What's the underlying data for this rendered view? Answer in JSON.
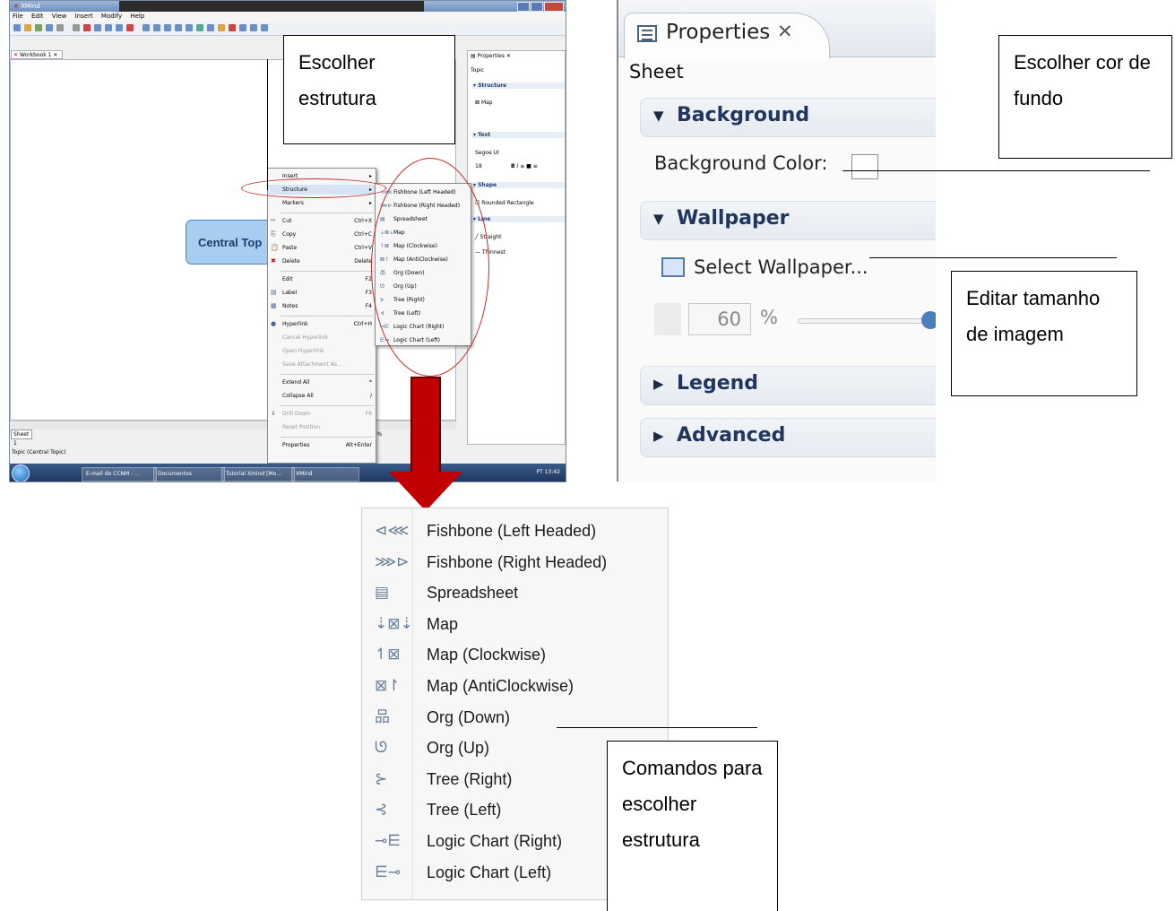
{
  "xmind_window": {
    "title": "XMind",
    "menu": [
      "File",
      "Edit",
      "View",
      "Insert",
      "Modify",
      "Help"
    ],
    "editor_tab": "Workbook 1",
    "central_topic": "Central Top",
    "sheet_tab": "Sheet 1",
    "zoom": "100%",
    "status": "Topic (Central Topic)",
    "taskbar": [
      "E-mail de CCNM - ...",
      "Documentos",
      "Tutorial Xmind [Mo...",
      "XMind"
    ],
    "tray": "PT  13:42",
    "properties": {
      "tab": "Properties",
      "context": "Topic",
      "structure_section": "Structure",
      "structure_value": "Map",
      "text_section": "Text",
      "font": "Segoe UI",
      "font_size": "18",
      "shape_section": "Shape",
      "shape_value": "Rounded Rectangle",
      "line_section": "Line",
      "line_style": "Straight",
      "line_width": "Thinnest"
    },
    "context_menu": [
      {
        "label": "Insert",
        "shortcut": "",
        "arrow": true,
        "disabled": false
      },
      {
        "label": "Structure",
        "shortcut": "",
        "arrow": true,
        "disabled": false
      },
      {
        "label": "Markers",
        "shortcut": "",
        "arrow": true,
        "disabled": false
      },
      {
        "label": "Cut",
        "shortcut": "Ctrl+X",
        "arrow": false,
        "disabled": false
      },
      {
        "label": "Copy",
        "shortcut": "Ctrl+C",
        "arrow": false,
        "disabled": false
      },
      {
        "label": "Paste",
        "shortcut": "Ctrl+V",
        "arrow": false,
        "disabled": false
      },
      {
        "label": "Delete",
        "shortcut": "Delete",
        "arrow": false,
        "disabled": false
      },
      {
        "label": "Edit",
        "shortcut": "F2",
        "arrow": false,
        "disabled": false
      },
      {
        "label": "Label",
        "shortcut": "F3",
        "arrow": false,
        "disabled": false
      },
      {
        "label": "Notes",
        "shortcut": "F4",
        "arrow": false,
        "disabled": false
      },
      {
        "label": "Hyperlink",
        "shortcut": "Ctrl+H",
        "arrow": false,
        "disabled": false
      },
      {
        "label": "Cancel Hyperlink",
        "shortcut": "",
        "arrow": false,
        "disabled": true
      },
      {
        "label": "Open Hyperlink",
        "shortcut": "",
        "arrow": false,
        "disabled": true
      },
      {
        "label": "Save Attachment As...",
        "shortcut": "",
        "arrow": false,
        "disabled": true
      },
      {
        "label": "Extend All",
        "shortcut": "*",
        "arrow": false,
        "disabled": false
      },
      {
        "label": "Collapse All",
        "shortcut": "/",
        "arrow": false,
        "disabled": false
      },
      {
        "label": "Drill Down",
        "shortcut": "F6",
        "arrow": false,
        "disabled": true
      },
      {
        "label": "Reset Position",
        "shortcut": "",
        "arrow": false,
        "disabled": true
      },
      {
        "label": "Properties",
        "shortcut": "Alt+Enter",
        "arrow": false,
        "disabled": false
      }
    ]
  },
  "structure_options": [
    {
      "label": "Fishbone (Left Headed)",
      "icon": "fishbone-left-icon",
      "glyph": "⊲⋘"
    },
    {
      "label": "Fishbone (Right Headed)",
      "icon": "fishbone-right-icon",
      "glyph": "⋙⊳"
    },
    {
      "label": "Spreadsheet",
      "icon": "spreadsheet-icon",
      "glyph": "▤"
    },
    {
      "label": "Map",
      "icon": "map-icon",
      "glyph": "⇣⊠⇣"
    },
    {
      "label": "Map (Clockwise)",
      "icon": "map-clockwise-icon",
      "glyph": "↿⊠"
    },
    {
      "label": "Map (AntiClockwise)",
      "icon": "map-anticlockwise-icon",
      "glyph": "⊠↾"
    },
    {
      "label": "Org (Down)",
      "icon": "org-down-icon",
      "glyph": "品"
    },
    {
      "label": "Org (Up)",
      "icon": "org-up-icon",
      "glyph": "ᘎ"
    },
    {
      "label": "Tree (Right)",
      "icon": "tree-right-icon",
      "glyph": "⊱"
    },
    {
      "label": "Tree (Left)",
      "icon": "tree-left-icon",
      "glyph": "⊰"
    },
    {
      "label": "Logic Chart (Right)",
      "icon": "logic-chart-right-icon",
      "glyph": "⊸⋿"
    },
    {
      "label": "Logic Chart (Left)",
      "icon": "logic-chart-left-icon",
      "glyph": "⋿⊸"
    }
  ],
  "properties_zoom": {
    "tab_label": "Properties",
    "context": "Sheet",
    "background_section": "Background",
    "background_color_label": "Background Color:",
    "wallpaper_section": "Wallpaper",
    "select_wallpaper": "Select Wallpaper...",
    "opacity_value": "60",
    "opacity_unit": "%",
    "opacity_level": 1.0,
    "legend_section": "Legend",
    "advanced_section": "Advanced"
  },
  "callouts": {
    "choose_structure": "Escolher estrutura",
    "choose_bg_color": "Escolher cor de fundo",
    "edit_image_size": "Editar tamanho de imagem",
    "structure_commands": "Comandos para escolher estrutura"
  },
  "colors": {
    "annotation_red": "#c62828",
    "arrow_red": "#c00000",
    "central_topic_fill": "#a7cdf0",
    "section_title": "#20365e"
  }
}
